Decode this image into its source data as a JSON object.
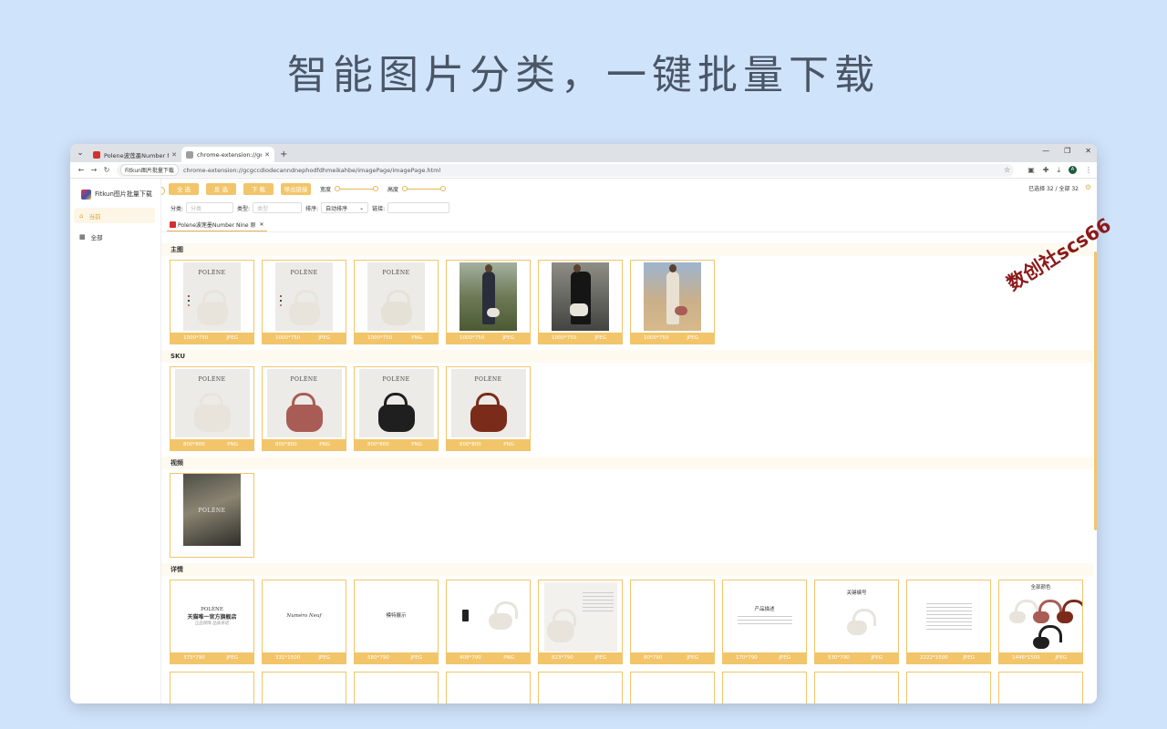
{
  "headline": "智能图片分类，一键批量下载",
  "browser": {
    "tabs": [
      {
        "title": "Polene波莲墨Number Nine 原",
        "favicon_color": "#d32f2f",
        "active": false
      },
      {
        "title": "chrome-extension://gcgccd",
        "favicon_color": "#9e9e9e",
        "active": true
      }
    ],
    "new_tab": "+",
    "site_chip": "Fitkun图片批量下载",
    "url": "chrome-extension://gcgccdiodecanndnephodfdhmeikahbe/imagePage/imagePage.html",
    "profile_initial": "A"
  },
  "app": {
    "brand": "Fitkun图片批量下载",
    "nav": [
      {
        "icon": "home-icon",
        "glyph": "⌂",
        "label": "当前",
        "active": true
      },
      {
        "icon": "grid-icon",
        "glyph": "▦",
        "label": "全部",
        "active": false
      }
    ],
    "toolbar": {
      "buttons": [
        "全 选",
        "反 选",
        "下 载",
        "导出链接"
      ],
      "width_label": "宽度",
      "height_label": "高度",
      "selection_status": "已选择 32 / 全部 32"
    },
    "filters": {
      "category_label": "分类:",
      "category_placeholder": "分类",
      "type_label": "类型:",
      "type_placeholder": "类型",
      "sort_label": "排序:",
      "sort_value": "自动排序",
      "link_label": "链接:"
    },
    "page_tab": "Polene波莲墨Number Nine 原"
  },
  "sections": [
    {
      "title": "主图",
      "items": [
        {
          "kind": "studio-dots",
          "size": "1000*750",
          "format": "JPEG"
        },
        {
          "kind": "studio-dots",
          "size": "1000*750",
          "format": "JPEG"
        },
        {
          "kind": "studio-strap",
          "size": "1000*750",
          "format": "PNG"
        },
        {
          "kind": "outdoor",
          "size": "1000*750",
          "format": "JPEG"
        },
        {
          "kind": "dark",
          "size": "1000*750",
          "format": "JPEG"
        },
        {
          "kind": "desert",
          "size": "1000*750",
          "format": "JPEG"
        }
      ]
    },
    {
      "title": "SKU",
      "items": [
        {
          "kind": "sku",
          "bag_color": "#e8e4dc",
          "size": "800*800",
          "format": "PNG"
        },
        {
          "kind": "sku",
          "bag_color": "#a95c55",
          "size": "800*800",
          "format": "PNG"
        },
        {
          "kind": "sku",
          "bag_color": "#1f1f1f",
          "size": "800*800",
          "format": "PNG"
        },
        {
          "kind": "sku",
          "bag_color": "#7a2b1a",
          "size": "800*800",
          "format": "PNG"
        }
      ]
    },
    {
      "title": "视频",
      "items": [
        {
          "kind": "video"
        }
      ]
    },
    {
      "title": "详情",
      "items": [
        {
          "kind": "doc-store",
          "text1": "POLÈNE",
          "text2": "天猫唯一官方旗舰店",
          "text3": "正品保障 品质承诺",
          "size": "375*790",
          "format": "JPEG"
        },
        {
          "kind": "doc-script",
          "text1": "Numéro Neuf",
          "size": "331*1500",
          "format": "JPEG"
        },
        {
          "kind": "doc-simple",
          "text1": "模特展示",
          "size": "580*790",
          "format": "JPEG"
        },
        {
          "kind": "doc-phone",
          "size": "408*790",
          "format": "PNG"
        },
        {
          "kind": "doc-detail",
          "size": "823*790",
          "format": "JPEG"
        },
        {
          "kind": "blank",
          "size": "80*790",
          "format": "JPEG"
        },
        {
          "kind": "doc-lines",
          "text1": "产品描述",
          "size": "170*790",
          "format": "JPEG"
        },
        {
          "kind": "doc-bag",
          "text1": "关键编号",
          "size": "530*790",
          "format": "JPEG"
        },
        {
          "kind": "doc-list",
          "size": "2222*1500",
          "format": "JPEG"
        },
        {
          "kind": "doc-colors",
          "text1": "全部颜色",
          "size": "1446*1500",
          "format": "JPEG"
        }
      ]
    }
  ],
  "watermark": "数创社scs66"
}
